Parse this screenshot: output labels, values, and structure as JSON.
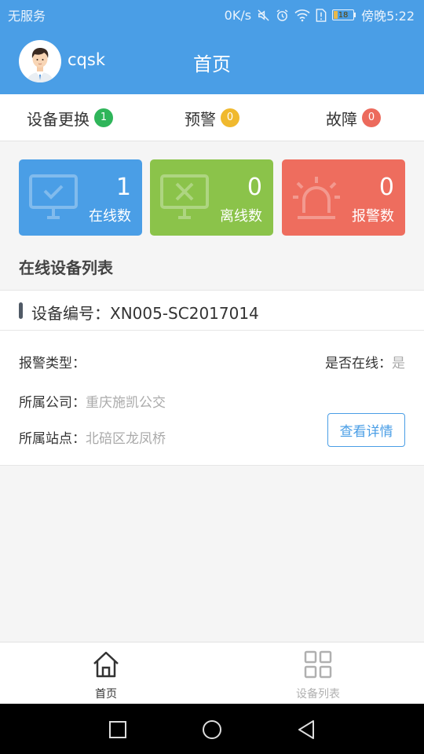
{
  "status_bar": {
    "carrier": "无服务",
    "speed": "0K/s",
    "battery_level": "18",
    "battery_fraction": 0.18,
    "time": "傍晚5:22",
    "icons": [
      "mute-icon",
      "alarm-icon",
      "wifi-icon",
      "sim-alert-icon",
      "battery-icon"
    ]
  },
  "header": {
    "username": "cqsk",
    "title": "首页",
    "color": "#4a9ee6"
  },
  "tabs": [
    {
      "label": "设备更换",
      "badge": "1",
      "badge_color": "#2fb55a"
    },
    {
      "label": "预警",
      "badge": "0",
      "badge_color": "#f0b92e"
    },
    {
      "label": "故障",
      "badge": "0",
      "badge_color": "#ec6a5c"
    }
  ],
  "stats": [
    {
      "value": "1",
      "label": "在线数",
      "color": "#4a9ee6",
      "icon": "monitor-check-icon"
    },
    {
      "value": "0",
      "label": "离线数",
      "color": "#8bc34a",
      "icon": "monitor-x-icon"
    },
    {
      "value": "0",
      "label": "报警数",
      "color": "#ee6d5e",
      "icon": "alarm-light-icon"
    }
  ],
  "section_title": "在线设备列表",
  "device": {
    "number_label": "设备编号：",
    "number": "XN005-SC2017014",
    "alarm_type_label": "报警类型：",
    "alarm_type": "",
    "online_label": "是否在线：",
    "online": "是",
    "company_label": "所属公司：",
    "company": "重庆施凯公交",
    "station_label": "所属站点：",
    "station": "北碚区龙凤桥",
    "detail_button": "查看详情"
  },
  "bottom_nav": [
    {
      "label": "首页",
      "icon": "home-icon",
      "active": true
    },
    {
      "label": "设备列表",
      "icon": "grid-icon",
      "active": false
    }
  ],
  "colors": {
    "active_nav": "#333333",
    "inactive_nav": "#b0b0b0"
  }
}
